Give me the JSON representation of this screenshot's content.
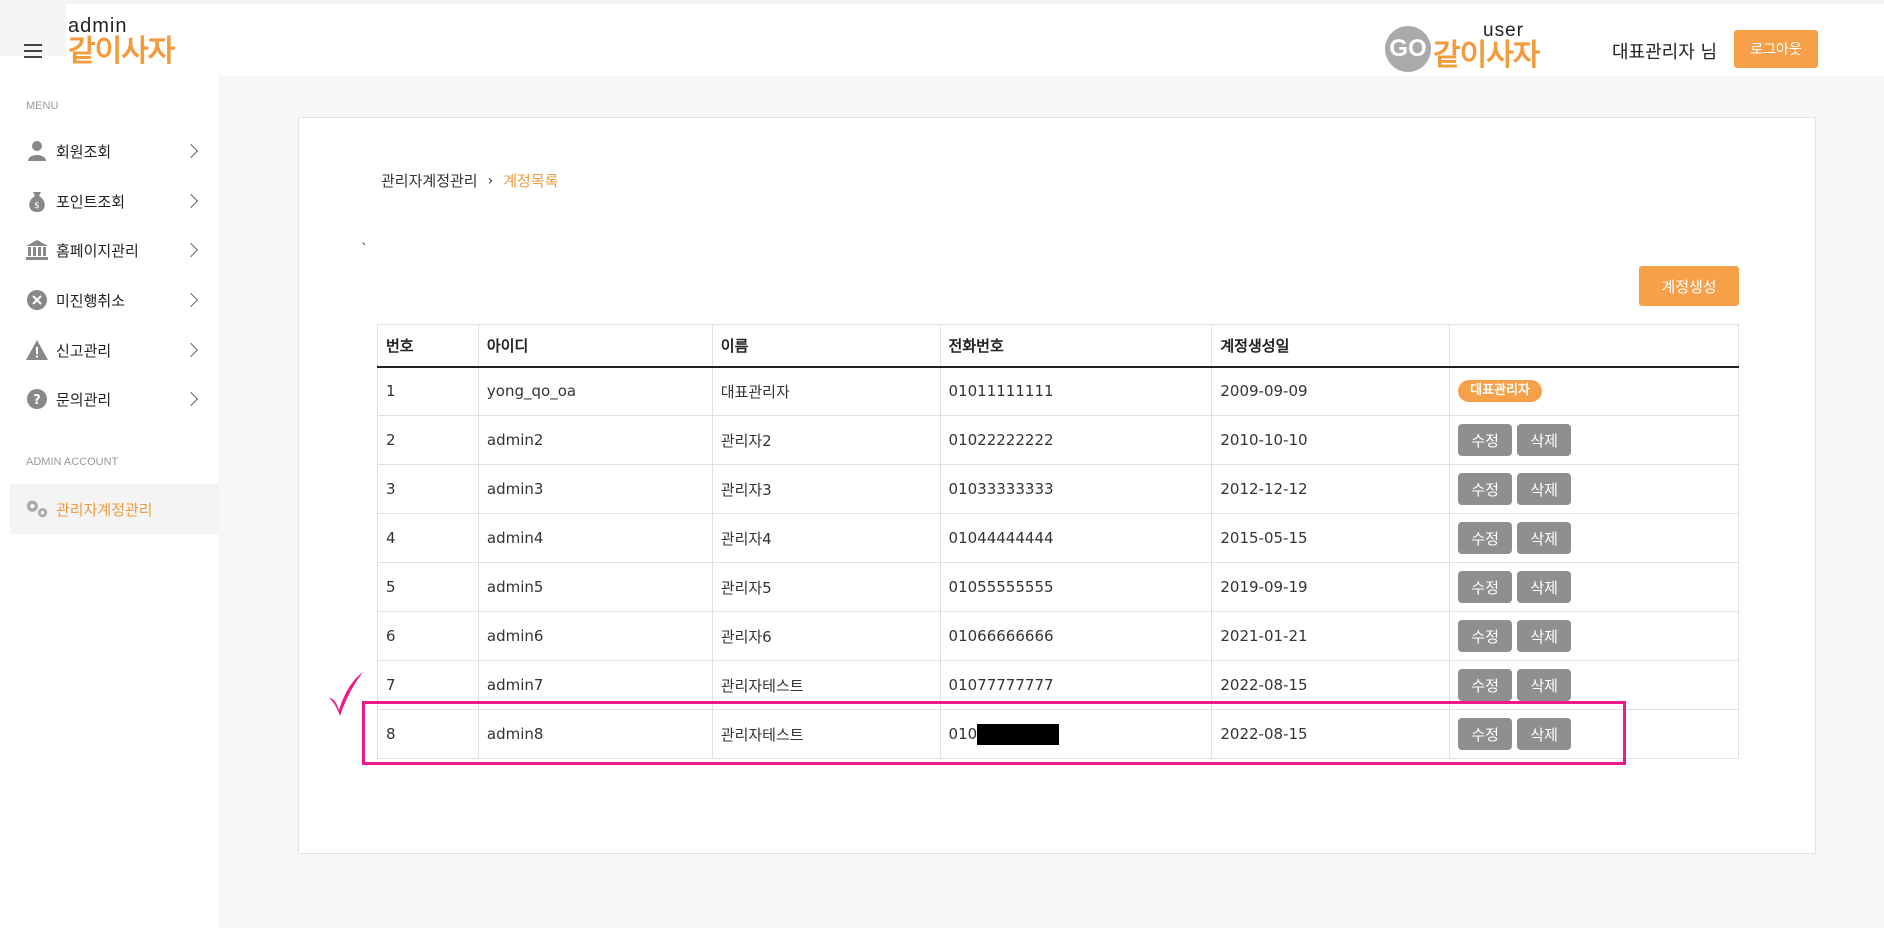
{
  "header": {
    "admin_logo_small": "admin",
    "admin_logo_big": "같이사자",
    "user_logo_go": "GO",
    "user_logo_small": "user",
    "user_logo_big": "같이사자",
    "user_greeting": "대표관리자 님",
    "logout_label": "로그아웃"
  },
  "sidebar": {
    "menu_title": "MENU",
    "items": [
      {
        "label": "회원조회",
        "icon": "user-icon"
      },
      {
        "label": "포인트조회",
        "icon": "money-bag-icon"
      },
      {
        "label": "홈페이지관리",
        "icon": "bank-icon"
      },
      {
        "label": "미진행취소",
        "icon": "close-circle-icon"
      },
      {
        "label": "신고관리",
        "icon": "warning-icon"
      },
      {
        "label": "문의관리",
        "icon": "question-icon"
      }
    ],
    "admin_title": "ADMIN ACCOUNT",
    "admin_item": {
      "label": "관리자계정관리",
      "icon": "gears-icon"
    }
  },
  "main": {
    "breadcrumb": {
      "parent": "관리자계정관리",
      "separator": "›",
      "current": "계정목록"
    },
    "stray_mark": "`",
    "create_button": "계정생성",
    "table": {
      "headers": [
        "번호",
        "아이디",
        "이름",
        "전화번호",
        "계정생성일",
        ""
      ],
      "rows": [
        {
          "no": "1",
          "id": "yong_qo_oa",
          "name": "대표관리자",
          "phone": "01011111111",
          "date": "2009-09-09",
          "badge": "대표관리자"
        },
        {
          "no": "2",
          "id": "admin2",
          "name": "관리자2",
          "phone": "01022222222",
          "date": "2010-10-10",
          "edit": "수정",
          "delete": "삭제"
        },
        {
          "no": "3",
          "id": "admin3",
          "name": "관리자3",
          "phone": "01033333333",
          "date": "2012-12-12",
          "edit": "수정",
          "delete": "삭제"
        },
        {
          "no": "4",
          "id": "admin4",
          "name": "관리자4",
          "phone": "01044444444",
          "date": "2015-05-15",
          "edit": "수정",
          "delete": "삭제"
        },
        {
          "no": "5",
          "id": "admin5",
          "name": "관리자5",
          "phone": "01055555555",
          "date": "2019-09-19",
          "edit": "수정",
          "delete": "삭제"
        },
        {
          "no": "6",
          "id": "admin6",
          "name": "관리자6",
          "phone": "01066666666",
          "date": "2021-01-21",
          "edit": "수정",
          "delete": "삭제"
        },
        {
          "no": "7",
          "id": "admin7",
          "name": "관리자테스트",
          "phone": "01077777777",
          "date": "2022-08-15",
          "edit": "수정",
          "delete": "삭제"
        },
        {
          "no": "8",
          "id": "admin8",
          "name": "관리자테스트",
          "phone": "010",
          "date": "2022-08-15",
          "edit": "수정",
          "delete": "삭제"
        }
      ]
    }
  },
  "colors": {
    "accent": "#f39a3b",
    "button_orange": "#f7a04a",
    "highlight": "#ec1a8c",
    "action_gray": "#8f8f8f"
  }
}
